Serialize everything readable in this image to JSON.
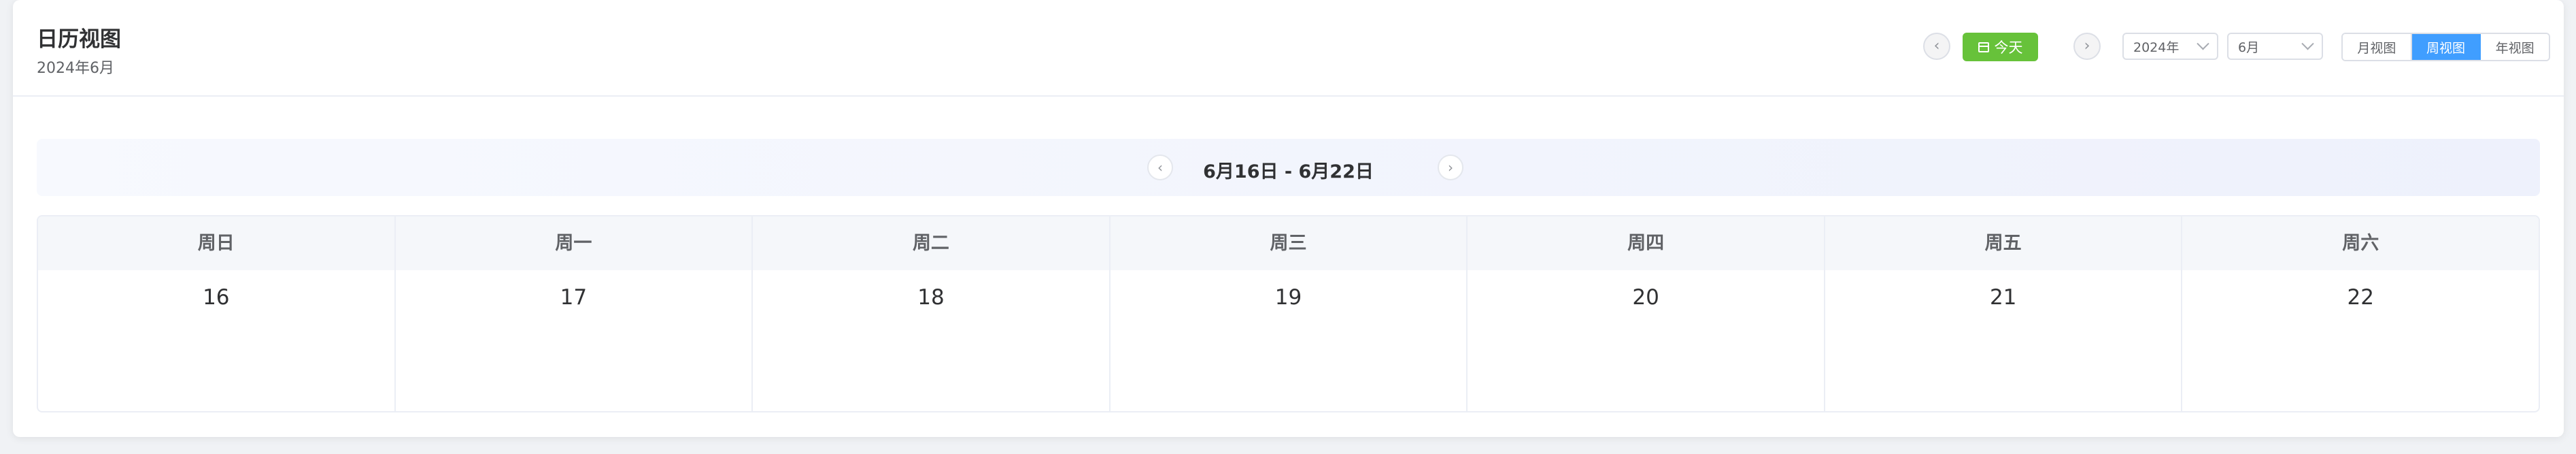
{
  "header": {
    "title": "日历视图",
    "subtitle": "2024年6月",
    "prev_icon": "chevron-left-icon",
    "next_icon": "chevron-right-icon",
    "today_label": "今天",
    "today_icon": "calendar-icon",
    "year_select": "2024年",
    "month_select": "6月",
    "views": [
      "月视图",
      "周视图",
      "年视图"
    ],
    "active_view": "周视图"
  },
  "week_nav": {
    "label": "6月16日 - 6月22日"
  },
  "week": {
    "headers": [
      "周日",
      "周一",
      "周二",
      "周三",
      "周四",
      "周五",
      "周六"
    ],
    "days": [
      "16",
      "17",
      "18",
      "19",
      "20",
      "21",
      "22"
    ]
  },
  "colors": {
    "today_button": "#67c23a",
    "active_view": "#409eff"
  }
}
